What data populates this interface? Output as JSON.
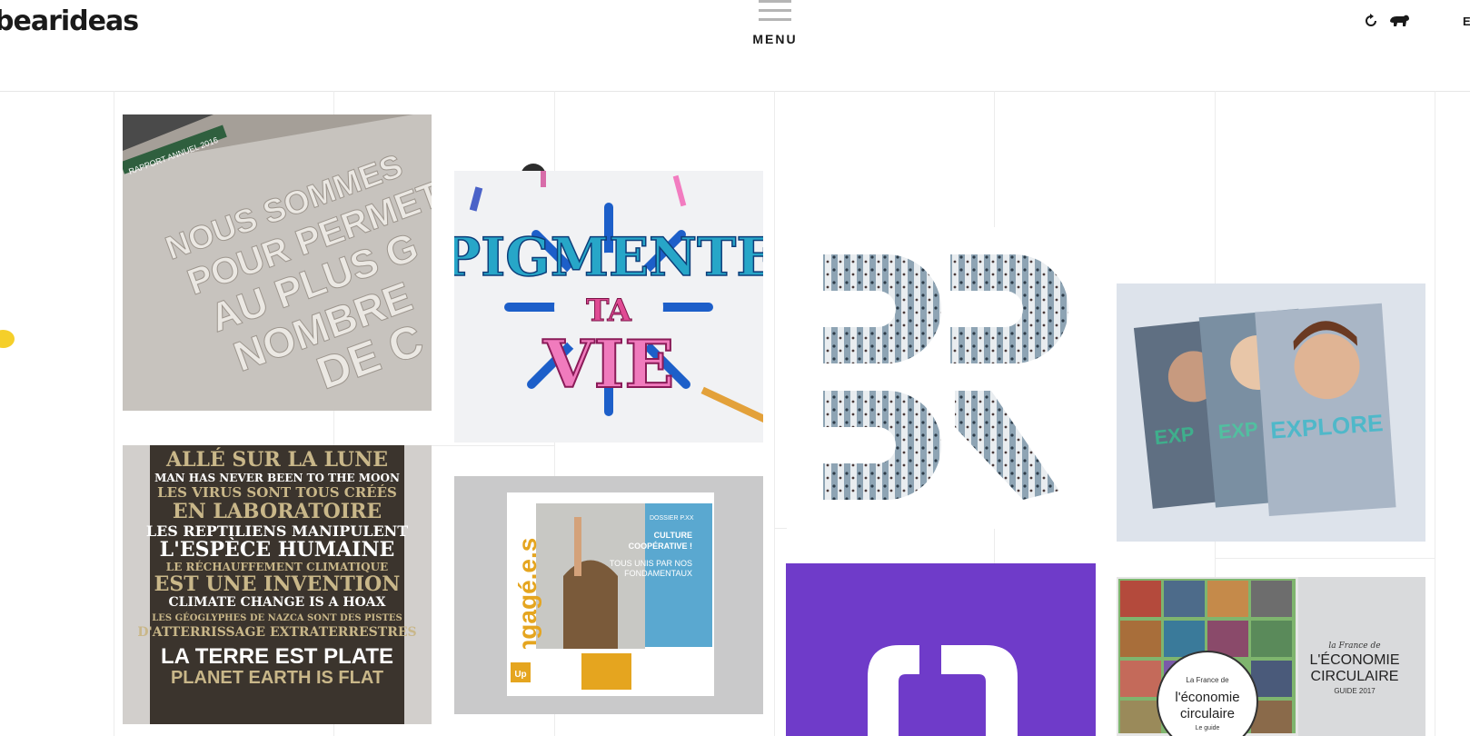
{
  "brand": {
    "logo_text": "bearideas"
  },
  "header": {
    "menu_label": "MENU",
    "lang_label": "E"
  },
  "icons": {
    "refresh": "refresh-icon",
    "bear": "bear-icon",
    "menu": "hamburger-icon"
  },
  "colors": {
    "accent_yellow": "#f5cf2a",
    "purple_tile": "#6f3bc9"
  },
  "portfolio": {
    "tile1": {
      "band_text": "RAPPORT ANNUEL 2016",
      "lines": [
        "NOUS SOMMES",
        "POUR PERMET",
        "AU PLUS G",
        "NOMBRE",
        "DE C"
      ]
    },
    "tile2": {
      "lines": [
        "PIGMENTE",
        "TA",
        "VIE"
      ]
    },
    "tile3": {
      "lines": [
        "ALLÉ SUR LA LUNE",
        "MAN HAS NEVER BEEN TO THE MOON",
        "LES VIRUS SONT TOUS CRÉÉS",
        "EN LABORATOIRE",
        "LES REPTILIENS MANIPULENT",
        "L'ESPÈCE HUMAINE",
        "LE RÉCHAUFFEMENT CLIMATIQUE",
        "EST UNE INVENTION",
        "CLIMATE CHANGE IS A HOAX",
        "LES GÉOGLYPHES DE NAZCA SONT DES PISTES",
        "D'ATTERRISSAGE EXTRATERRESTRES",
        "LA TERRE EST PLATE",
        "PLANET EARTH IS FLAT"
      ]
    },
    "tile4": {
      "masthead": "engagé.e.s",
      "dossier": "DOSSIER  P.XX",
      "headline1": "CULTURE",
      "headline2": "COOPÉRATIVE !",
      "headline3": "TOUS UNIS PAR NOS",
      "headline4": "FONDAMENTAUX",
      "logo": "Up"
    },
    "tile5": {
      "covers": [
        "EXP",
        "EXP",
        "EXPLORE"
      ]
    },
    "tile6": {
      "seal_small": "La France de",
      "seal_big1": "l'économie",
      "seal_big2": "circulaire",
      "seal_sub": "Le guide",
      "right_small": "la France de",
      "right_big1": "L'ÉCONOMIE",
      "right_big2": "CIRCULAIRE",
      "right_sub": "GUIDE 2017"
    }
  }
}
